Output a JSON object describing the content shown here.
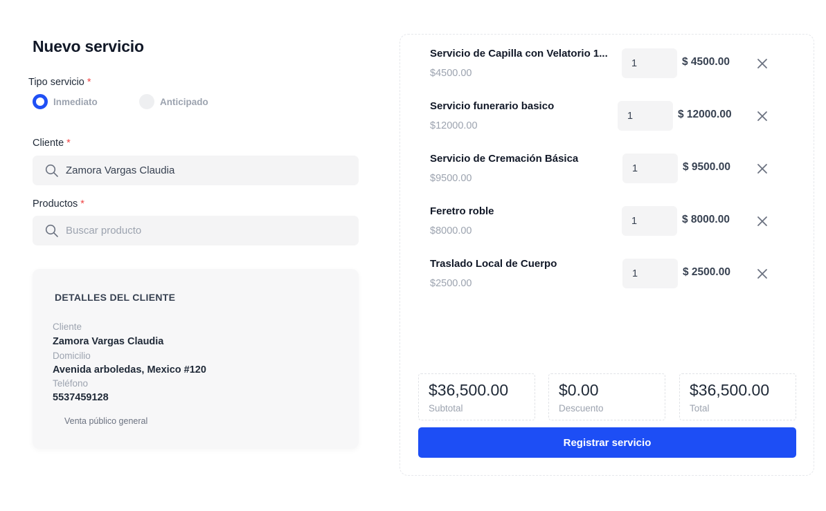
{
  "page": {
    "title": "Nuevo servicio"
  },
  "form": {
    "tipo_label": "Tipo servicio",
    "required_mark": "*",
    "options": [
      "Inmediato",
      "Anticipado"
    ],
    "selected_option": "Inmediato",
    "cliente_label": "Cliente",
    "cliente_value": "Zamora Vargas Claudia",
    "productos_label": "Productos",
    "productos_placeholder": "Buscar producto"
  },
  "details": {
    "title": "DETALLES DEL CLIENTE",
    "cliente_label": "Cliente",
    "cliente_value": "Zamora Vargas Claudia",
    "domicilio_label": "Domicilio",
    "domicilio_value": "Avenida arboledas, Mexico #120",
    "telefono_label": "Teléfono",
    "telefono_value": "5537459128",
    "note": "Venta público general"
  },
  "cart": {
    "items": [
      {
        "name": "Servicio de Capilla con Velatorio 1...",
        "price": "$4500.00",
        "qty": "1",
        "total": "$ 4500.00"
      },
      {
        "name": "Servicio funerario basico",
        "price": "$12000.00",
        "qty": "1",
        "total": "$ 12000.00"
      },
      {
        "name": "Servicio de Cremación Básica",
        "price": "$9500.00",
        "qty": "1",
        "total": "$ 9500.00"
      },
      {
        "name": "Feretro roble",
        "price": "$8000.00",
        "qty": "1",
        "total": "$ 8000.00"
      },
      {
        "name": "Traslado Local de Cuerpo",
        "price": "$2500.00",
        "qty": "1",
        "total": "$ 2500.00"
      }
    ]
  },
  "summary": {
    "subtotal_label": "Subtotal",
    "subtotal_value": "$36,500.00",
    "descuento_label": "Descuento",
    "descuento_value": "$0.00",
    "total_label": "Total",
    "total_value": "$36,500.00"
  },
  "actions": {
    "submit_label": "Registrar servicio"
  },
  "icons": {
    "search": "search-icon",
    "remove": "close-icon"
  },
  "colors": {
    "accent": "#1d4ef5",
    "required": "#ef4444",
    "muted": "#9ca3af"
  }
}
